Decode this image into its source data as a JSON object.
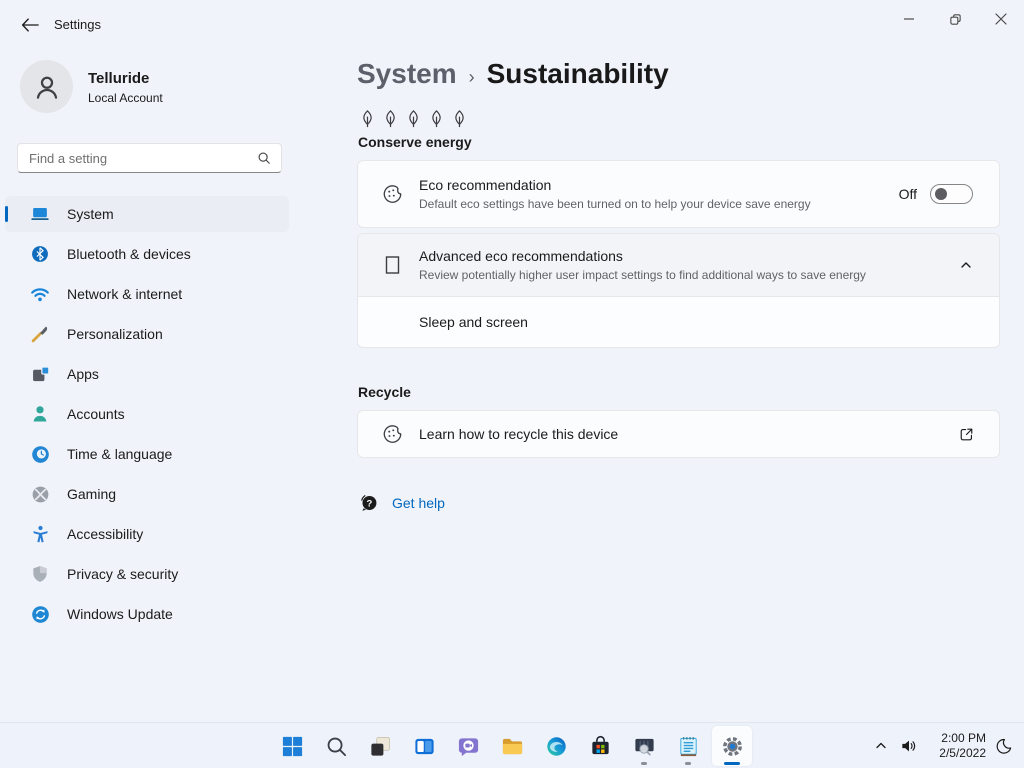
{
  "titlebar": {
    "app_title": "Settings"
  },
  "sidebar": {
    "user": {
      "name": "Telluride",
      "account_type": "Local Account"
    },
    "search_placeholder": "Find a setting",
    "items": [
      {
        "label": "System",
        "selected": true
      },
      {
        "label": "Bluetooth & devices",
        "selected": false
      },
      {
        "label": "Network & internet",
        "selected": false
      },
      {
        "label": "Personalization",
        "selected": false
      },
      {
        "label": "Apps",
        "selected": false
      },
      {
        "label": "Accounts",
        "selected": false
      },
      {
        "label": "Time & language",
        "selected": false
      },
      {
        "label": "Gaming",
        "selected": false
      },
      {
        "label": "Accessibility",
        "selected": false
      },
      {
        "label": "Privacy & security",
        "selected": false
      },
      {
        "label": "Windows Update",
        "selected": false
      }
    ]
  },
  "main": {
    "breadcrumb": {
      "parent": "System",
      "separator": "›",
      "current": "Sustainability"
    },
    "conserve_energy_label": "Conserve energy",
    "eco_card": {
      "title": "Eco recommendation",
      "description": "Default eco settings have been turned on to help your device save energy",
      "toggle_label": "Off",
      "toggle_state": "off"
    },
    "advanced_card": {
      "title": "Advanced eco recommendations",
      "description": "Review potentially higher user impact settings to find additional ways to save energy",
      "expanded": true,
      "sub_item": "Sleep and screen"
    },
    "recycle_section": {
      "header": "Recycle",
      "link_title": "Learn how to recycle this device"
    },
    "get_help_label": "Get help"
  },
  "taskbar": {
    "tray": {
      "time": "2:00 PM",
      "date": "2/5/2022"
    }
  },
  "colors": {
    "accent": "#0067c0",
    "link": "#0067c0"
  }
}
